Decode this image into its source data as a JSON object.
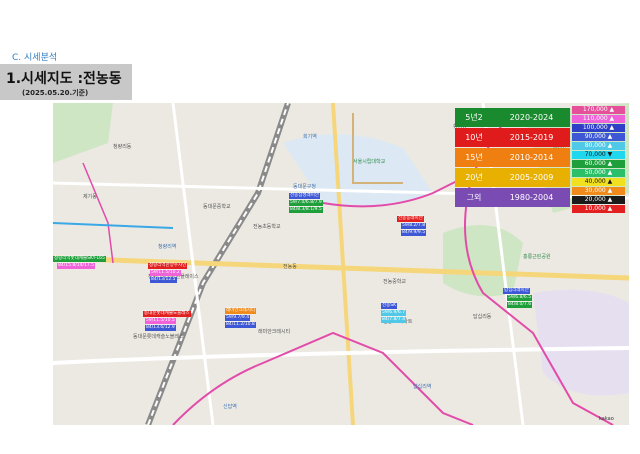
{
  "header": {
    "section": "C. 시세분석",
    "title": "1.시세지도 :전농동",
    "date": "(2025.05.20.기준)"
  },
  "year_legend": [
    {
      "label": "5년2",
      "range": "2020-2024",
      "color": "#1a8a2e"
    },
    {
      "label": "10년",
      "range": "2015-2019",
      "color": "#e01b1b"
    },
    {
      "label": "15년",
      "range": "2010-2014",
      "color": "#f07f12"
    },
    {
      "label": "20년",
      "range": "2005-2009",
      "color": "#e8b000"
    },
    {
      "label": "그외",
      "range": "1980-2004",
      "color": "#7a4bb3"
    }
  ],
  "price_legend": [
    {
      "label": "170,000 ▲",
      "bg": "#e64f9a",
      "fg": "#ffffff"
    },
    {
      "label": "110,000 ▲",
      "bg": "#f062d8",
      "fg": "#ffffff"
    },
    {
      "label": "100,000 ▲",
      "bg": "#2f3fc8",
      "fg": "#ffffff"
    },
    {
      "label": "90,000 ▲",
      "bg": "#3e57d4",
      "fg": "#ffffff"
    },
    {
      "label": "80,000 ▲",
      "bg": "#50c8e8",
      "fg": "#ffffff"
    },
    {
      "label": "70,000 ▼",
      "bg": "#1fd8f0",
      "fg": "#111111"
    },
    {
      "label": "60,000 ▲",
      "bg": "#1e9f3c",
      "fg": "#ffffff"
    },
    {
      "label": "50,000 ▲",
      "bg": "#2bbf6a",
      "fg": "#ffffff"
    },
    {
      "label": "40,000 ▲",
      "bg": "#f0e020",
      "fg": "#111111"
    },
    {
      "label": "30,000 ▲",
      "bg": "#f08a1a",
      "fg": "#ffffff"
    },
    {
      "label": "20,000 ▲",
      "bg": "#1a1a1a",
      "fg": "#ffffff"
    },
    {
      "label": "10,000 ▲",
      "bg": "#e22020",
      "fg": "#ffffff"
    }
  ],
  "map": {
    "credit": "kakao",
    "labels": [
      {
        "text": "청량리역",
        "cls": "blue"
      },
      {
        "text": "전농동",
        "cls": ""
      },
      {
        "text": "동대문구청",
        "cls": "blue"
      },
      {
        "text": "서울시립대학교",
        "cls": "green"
      },
      {
        "text": "배봉산",
        "cls": "green"
      },
      {
        "text": "전농초등학교",
        "cls": ""
      },
      {
        "text": "답십리역",
        "cls": "blue"
      },
      {
        "text": "신답역",
        "cls": "blue"
      },
      {
        "text": "전농중학교",
        "cls": ""
      },
      {
        "text": "동대문중학교",
        "cls": ""
      },
      {
        "text": "휘경동",
        "cls": ""
      },
      {
        "text": "회기역",
        "cls": "blue"
      },
      {
        "text": "제기동",
        "cls": ""
      },
      {
        "text": "답십리동",
        "cls": ""
      },
      {
        "text": "청량리동",
        "cls": ""
      },
      {
        "text": "래미안크레시티",
        "cls": ""
      },
      {
        "text": "동대문롯데캐슬노블레스",
        "cls": ""
      },
      {
        "text": "청량리역해링턴플레이스",
        "cls": ""
      },
      {
        "text": "전농SK아파트",
        "cls": ""
      },
      {
        "text": "홍릉근린공원",
        "cls": "green"
      }
    ],
    "tags": [
      {
        "text": "전농삼성래미안",
        "bg": "#3e57d4"
      },
      {
        "text": "59/7.0/6.8/7.9",
        "bg": "#1e9f3c"
      },
      {
        "text": "84/8.3/8.1/9.5",
        "bg": "#1e9f3c"
      },
      {
        "text": "청량리역롯데캐슬SKY-L65",
        "bg": "#1e9f3c"
      },
      {
        "text": "84/15.8/14/17.5",
        "bg": "#f062d8"
      },
      {
        "text": "청량리역한양수자인",
        "bg": "#e22020"
      },
      {
        "text": "59/11.5/10.2",
        "bg": "#f062d8"
      },
      {
        "text": "84/13/12.5",
        "bg": "#3e57d4"
      },
      {
        "text": "동대문롯데캐슬노블레스",
        "bg": "#e22020"
      },
      {
        "text": "59/11.5/10.5",
        "bg": "#f062d8"
      },
      {
        "text": "84/13.6/12.9",
        "bg": "#3e57d4"
      },
      {
        "text": "래미안크레시티",
        "bg": "#f08a1a"
      },
      {
        "text": "59/9.7/9.4",
        "bg": "#3e57d4"
      },
      {
        "text": "84/11.2/10.8",
        "bg": "#3e57d4"
      },
      {
        "text": "전농동래미안",
        "bg": "#e22020"
      },
      {
        "text": "59/8.2/7.8",
        "bg": "#3e57d4"
      },
      {
        "text": "84/9.9/9.5",
        "bg": "#3e57d4"
      },
      {
        "text": "전농SK",
        "bg": "#3e57d4"
      },
      {
        "text": "59/6.9/6.7",
        "bg": "#50c8e8"
      },
      {
        "text": "84/7.8/7.4",
        "bg": "#50c8e8"
      },
      {
        "text": "답십리래미안",
        "bg": "#3e57d4"
      },
      {
        "text": "59/6.8/6.5",
        "bg": "#1e9f3c"
      },
      {
        "text": "84/8.0/7.6",
        "bg": "#1e9f3c"
      }
    ]
  }
}
